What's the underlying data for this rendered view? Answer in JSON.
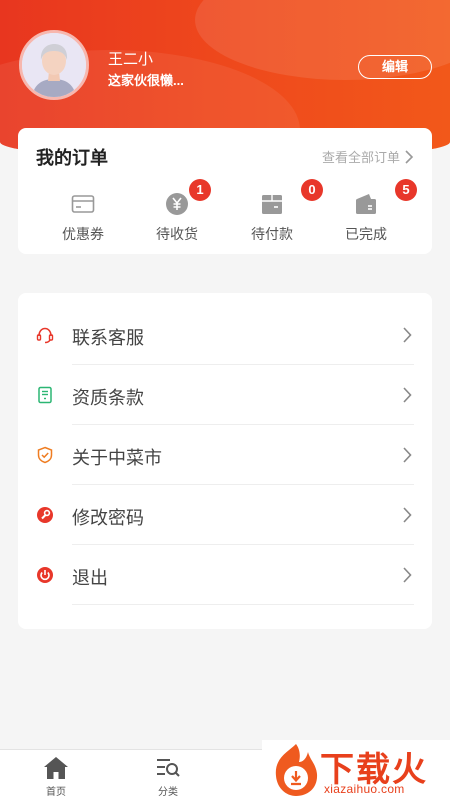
{
  "profile": {
    "name": "王二小",
    "signature": "这家伙很懒...",
    "edit_label": "编辑"
  },
  "orders": {
    "title": "我的订单",
    "view_all": "查看全部订单",
    "items": [
      {
        "label": "优惠券",
        "icon": "coupon-icon",
        "badge": ""
      },
      {
        "label": "待收货",
        "icon": "yen-icon",
        "badge": "1"
      },
      {
        "label": "待付款",
        "icon": "box-icon",
        "badge": "0"
      },
      {
        "label": "已完成",
        "icon": "wallet-icon",
        "badge": "5"
      }
    ]
  },
  "menu": [
    {
      "label": "联系客服",
      "icon": "headset-icon",
      "color": "#e8372a"
    },
    {
      "label": "资质条款",
      "icon": "document-icon",
      "color": "#2bb673"
    },
    {
      "label": "关于中菜市",
      "icon": "shield-icon",
      "color": "#ef7d22"
    },
    {
      "label": "修改密码",
      "icon": "wrench-icon",
      "color": "#e8372a"
    },
    {
      "label": "退出",
      "icon": "power-icon",
      "color": "#e8372a"
    }
  ],
  "tabbar": [
    {
      "label": "首页",
      "icon": "home-icon"
    },
    {
      "label": "分类",
      "icon": "category-search-icon"
    }
  ],
  "watermark": {
    "title": "下载火",
    "url": "xiazaihuo.com"
  },
  "colors": {
    "brand": "#e8361f",
    "badge": "#e8372a"
  }
}
